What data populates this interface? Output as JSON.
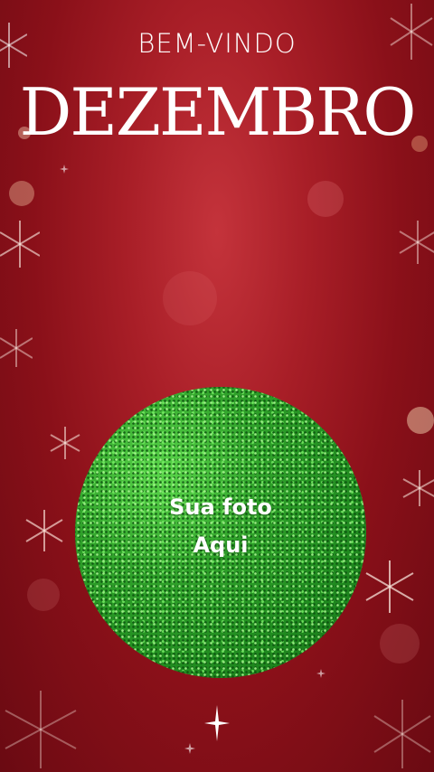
{
  "header": {
    "welcome": "BEM-VINDO",
    "month": "DEZEMBRO"
  },
  "photo_slot": {
    "line1": "Sua foto",
    "line2": "Aqui"
  },
  "colors": {
    "background": "#a81e27",
    "accent_green": "#2fa12a",
    "text": "#ffffff"
  },
  "icons": [
    "snowflake-icon",
    "sparkle-star-icon"
  ]
}
